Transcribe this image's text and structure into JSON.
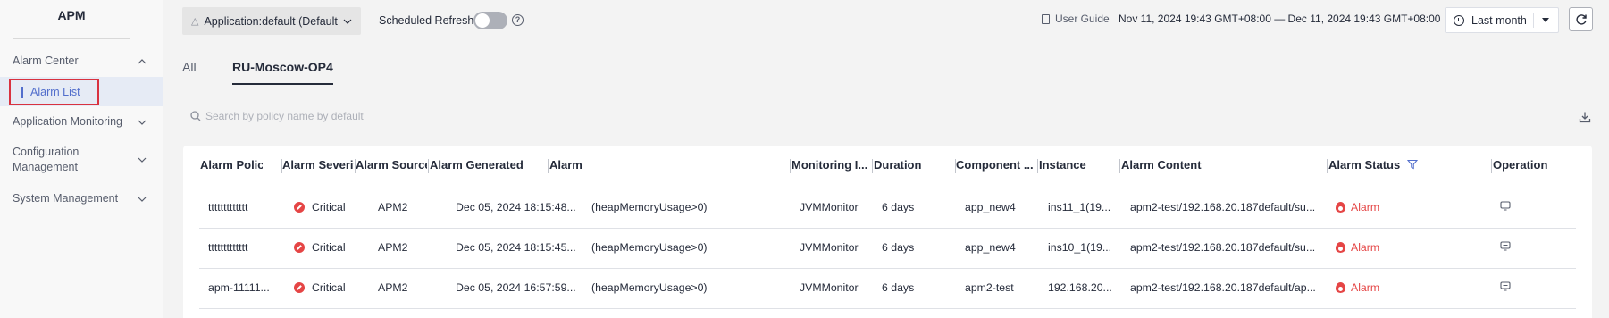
{
  "sidebar": {
    "app_title": "APM",
    "items": [
      {
        "label": "Alarm Center"
      },
      {
        "label": "Alarm List"
      },
      {
        "label": "Application Monitoring"
      },
      {
        "label": "Configuration Management"
      },
      {
        "label": "System Management"
      }
    ]
  },
  "topbar": {
    "app_select": "Application:default (Default",
    "scheduled_refresh_label": "Scheduled Refresh",
    "scheduled_refresh_on": false,
    "user_guide": "User Guide",
    "time_range": "Nov 11, 2024 19:43 GMT+08:00 — Dec 11, 2024 19:43 GMT+08:00",
    "period": "Last month"
  },
  "tabs": [
    {
      "label": "All",
      "active": false
    },
    {
      "label": "RU-Moscow-OP4",
      "active": true
    }
  ],
  "search": {
    "placeholder": "Search by policy name by default",
    "value": ""
  },
  "table": {
    "columns": [
      "Alarm Policy",
      "Alarm Severity",
      "Alarm Source",
      "Alarm Generated",
      "Alarm",
      "Monitoring I...",
      "Duration",
      "Component ...",
      "Instance",
      "Alarm Content",
      "Alarm Status",
      "Operation"
    ],
    "rows": [
      {
        "policy": "ttttttttttttt",
        "severity": "Critical",
        "source": "APM2",
        "generated": "Dec 05, 2024 18:15:48...",
        "alarm": "(heapMemoryUsage>0)",
        "monitoring": "JVMMonitor",
        "duration": "6 days",
        "component": "app_new4",
        "instance": "ins11_1(19...",
        "content": "apm2-test/192.168.20.187default/su...",
        "status": "Alarm"
      },
      {
        "policy": "ttttttttttttt",
        "severity": "Critical",
        "source": "APM2",
        "generated": "Dec 05, 2024 18:15:45...",
        "alarm": "(heapMemoryUsage>0)",
        "monitoring": "JVMMonitor",
        "duration": "6 days",
        "component": "app_new4",
        "instance": "ins10_1(19...",
        "content": "apm2-test/192.168.20.187default/su...",
        "status": "Alarm"
      },
      {
        "policy": "apm-11111...",
        "severity": "Critical",
        "source": "APM2",
        "generated": "Dec 05, 2024 16:57:59...",
        "alarm": "(heapMemoryUsage>0)",
        "monitoring": "JVMMonitor",
        "duration": "6 days",
        "component": "apm2-test",
        "instance": "192.168.20...",
        "content": "apm2-test/192.168.20.187default/ap...",
        "status": "Alarm"
      }
    ]
  },
  "colors": {
    "accent": "#526ecc",
    "critical": "#e54545",
    "highlight_border": "#d9323f"
  }
}
